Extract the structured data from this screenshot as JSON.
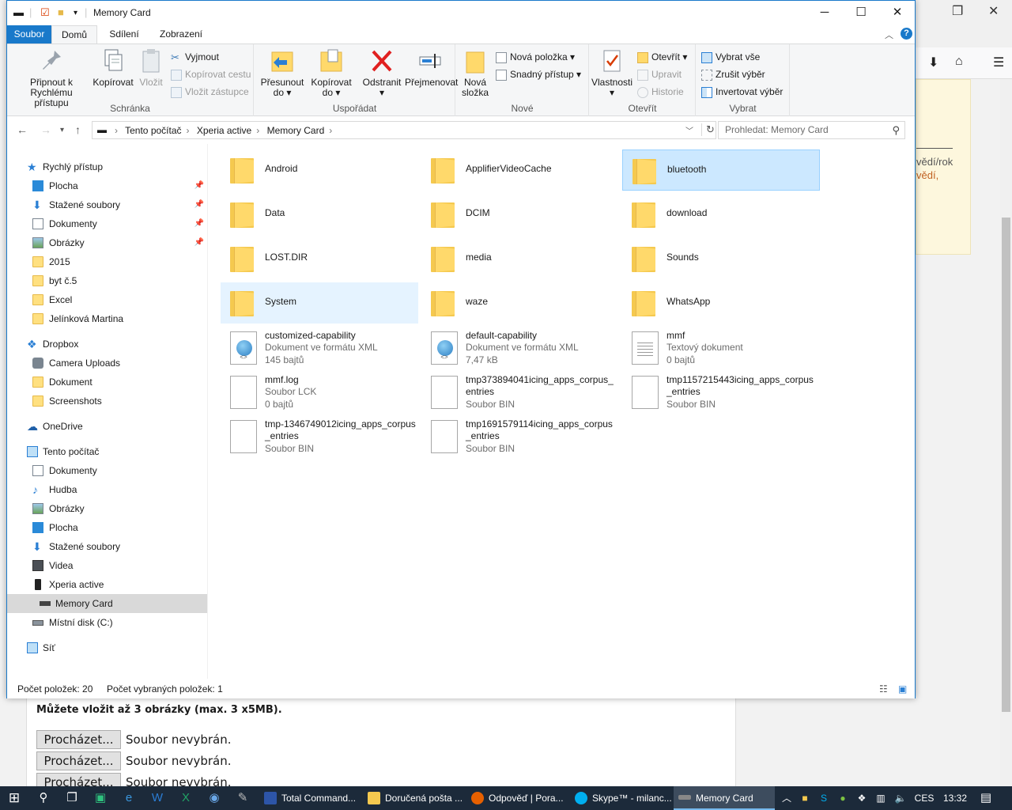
{
  "background": {
    "panel_text_1": "vědí/rok",
    "panel_text_2": "vědí,",
    "form_note": "Můžete vložit až 3 obrázky (max. 3 x5MB).",
    "uploads": [
      {
        "button": "Procházet...",
        "status": "Soubor nevybrán."
      },
      {
        "button": "Procházet...",
        "status": "Soubor nevybrán."
      },
      {
        "button": "Procházet...",
        "status": "Soubor nevybrán."
      }
    ]
  },
  "window": {
    "title": "Memory Card"
  },
  "ribbon": {
    "tabs": [
      "Soubor",
      "Domů",
      "Sdílení",
      "Zobrazení"
    ],
    "clipboard": {
      "label": "Schránka",
      "pin_line1": "Připnout k",
      "pin_line2": "Rychlému přístupu",
      "copy": "Kopírovat",
      "paste": "Vložit",
      "cut": "Vyjmout",
      "copy_path": "Kopírovat cestu",
      "paste_shortcut": "Vložit zástupce"
    },
    "organize": {
      "label": "Uspořádat",
      "move_line1": "Přesunout",
      "move_line2": "do",
      "copyto_line1": "Kopírovat",
      "copyto_line2": "do",
      "delete": "Odstranit",
      "rename": "Přejmenovat"
    },
    "new": {
      "label": "Nové",
      "folder_line1": "Nová",
      "folder_line2": "složka",
      "new_item": "Nová položka",
      "easy_access": "Snadný přístup"
    },
    "open": {
      "label": "Otevřít",
      "properties": "Vlastnosti",
      "open": "Otevřít",
      "edit": "Upravit",
      "history": "Historie"
    },
    "select": {
      "label": "Vybrat",
      "select_all": "Vybrat vše",
      "select_none": "Zrušit výběr",
      "invert": "Invertovat výběr"
    }
  },
  "address": {
    "crumbs": [
      "Tento počítač",
      "Xperia active",
      "Memory Card"
    ],
    "search_placeholder": "Prohledat: Memory Card"
  },
  "nav": {
    "quick_access": "Rychlý přístup",
    "qa_items": [
      "Plocha",
      "Stažené soubory",
      "Dokumenty",
      "Obrázky",
      "2015",
      "byt č.5",
      "Excel",
      "Jelínková Martina"
    ],
    "dropbox": "Dropbox",
    "dropbox_items": [
      "Camera Uploads",
      "Dokument",
      "Screenshots"
    ],
    "onedrive": "OneDrive",
    "this_pc": "Tento počítač",
    "pc_items": [
      "Dokumenty",
      "Hudba",
      "Obrázky",
      "Plocha",
      "Stažené soubory",
      "Videa",
      "Xperia active"
    ],
    "memory_card": "Memory Card",
    "local_disk": "Místní disk (C:)",
    "network": "Síť"
  },
  "folders": [
    "Android",
    "ApplifierVideoCache",
    "bluetooth",
    "Data",
    "DCIM",
    "download",
    "LOST.DIR",
    "media",
    "Sounds",
    "System",
    "waze",
    "WhatsApp"
  ],
  "files": [
    {
      "name": "customized-capability",
      "type": "Dokument ve formátu XML",
      "size": "145 bajtů",
      "icon": "xml-file-icon"
    },
    {
      "name": "default-capability",
      "type": "Dokument ve formátu XML",
      "size": "7,47 kB",
      "icon": "xml-file-icon"
    },
    {
      "name": "mmf",
      "type": "Textový dokument",
      "size": "0 bajtů",
      "icon": "text-file-icon"
    },
    {
      "name": "mmf.log",
      "type": "Soubor LCK",
      "size": "0 bajtů",
      "icon": "blank-file-icon"
    },
    {
      "name": "tmp373894041icing_apps_corpus_entries",
      "type": "Soubor BIN",
      "size": "",
      "icon": "blank-file-icon"
    },
    {
      "name": "tmp1157215443icing_apps_corpus_entries",
      "type": "Soubor BIN",
      "size": "",
      "icon": "blank-file-icon"
    },
    {
      "name": "tmp-1346749012icing_apps_corpus_entries",
      "type": "Soubor BIN",
      "size": "",
      "icon": "blank-file-icon"
    },
    {
      "name": "tmp1691579114icing_apps_corpus_entries",
      "type": "Soubor BIN",
      "size": "",
      "icon": "blank-file-icon"
    }
  ],
  "status": {
    "count": "Počet položek: 20",
    "selected": "Počet vybraných položek: 1"
  },
  "taskbar": {
    "apps": [
      "Total Command...",
      "Doručená pošta ...",
      "Odpověď | Pora...",
      "Skype™ - milanc...",
      "Memory Card"
    ],
    "lang": "CES",
    "time": "13:32"
  },
  "colors": {
    "accent": "#1979ca",
    "selection": "#cce8ff",
    "taskbar": "#1c2a3a"
  }
}
